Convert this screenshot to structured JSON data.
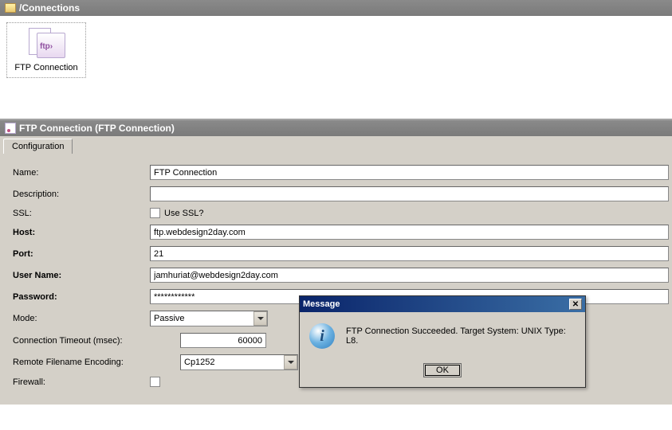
{
  "header": {
    "title": "/Connections"
  },
  "connection_item": {
    "label": "FTP Connection",
    "icon_text": "ftp›"
  },
  "panel": {
    "title": "FTP Connection (FTP Connection)"
  },
  "tabs": {
    "configuration": "Configuration"
  },
  "form": {
    "name_label": "Name:",
    "name_value": "FTP Connection",
    "description_label": "Description:",
    "description_value": "",
    "ssl_label": "SSL:",
    "ssl_checkbox_label": "Use SSL?",
    "ssl_checked": false,
    "host_label": "Host:",
    "host_value": "ftp.webdesign2day.com",
    "port_label": "Port:",
    "port_value": "21",
    "username_label": "User Name:",
    "username_value": "jamhuriat@webdesign2day.com",
    "password_label": "Password:",
    "password_value": "************",
    "mode_label": "Mode:",
    "mode_value": "Passive",
    "timeout_label": "Connection Timeout (msec):",
    "timeout_value": "60000",
    "encoding_label": "Remote Filename Encoding:",
    "encoding_value": "Cp1252",
    "firewall_label": "Firewall:",
    "firewall_checked": false
  },
  "dialog": {
    "title": "Message",
    "message": "FTP Connection Succeeded.  Target System: UNIX Type: L8.",
    "ok_label": "OK",
    "close_symbol": "✕"
  }
}
